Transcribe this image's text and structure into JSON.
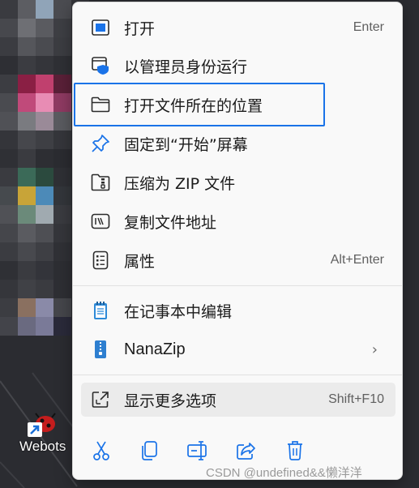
{
  "desktop": {
    "shortcut_label": "Webots"
  },
  "menu": {
    "items": [
      {
        "label": "打开",
        "shortcut": "Enter",
        "icon": "app-window-icon"
      },
      {
        "label": "以管理员身份运行",
        "shortcut": "",
        "icon": "admin-shield-icon"
      },
      {
        "label": "打开文件所在的位置",
        "shortcut": "",
        "icon": "folder-icon"
      },
      {
        "label": "固定到“开始”屏幕",
        "shortcut": "",
        "icon": "pin-icon"
      },
      {
        "label": "压缩为 ZIP 文件",
        "shortcut": "",
        "icon": "zip-folder-icon"
      },
      {
        "label": "复制文件地址",
        "shortcut": "",
        "icon": "copy-path-icon"
      },
      {
        "label": "属性",
        "shortcut": "Alt+Enter",
        "icon": "properties-icon"
      },
      {
        "label": "在记事本中编辑",
        "shortcut": "",
        "icon": "notepad-icon"
      },
      {
        "label": "NanaZip",
        "shortcut": "",
        "icon": "nanazip-icon"
      },
      {
        "label": "显示更多选项",
        "shortcut": "Shift+F10",
        "icon": "more-options-icon"
      }
    ],
    "toolbar": [
      "cut-icon",
      "copy-icon",
      "rename-icon",
      "share-icon",
      "delete-icon"
    ],
    "accent": "#1a73e8"
  },
  "watermark": "CSDN @undefined&&懒洋洋"
}
